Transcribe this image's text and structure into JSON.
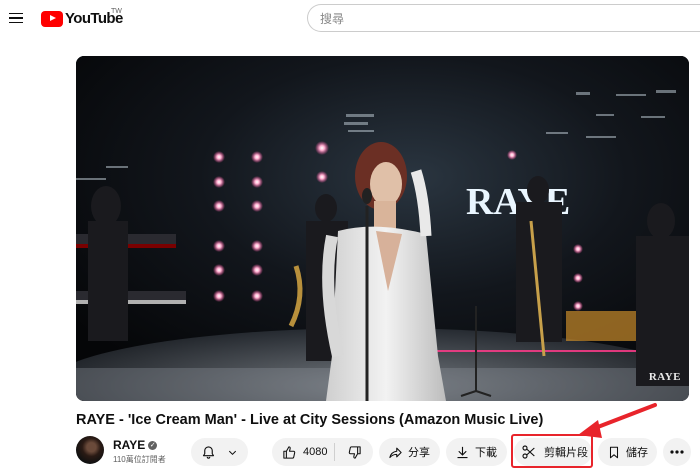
{
  "header": {
    "logo_text": "YouTube",
    "logo_region": "TW",
    "search_placeholder": "搜尋"
  },
  "video": {
    "watermark": "RAYE",
    "stage_sign": "RAYE",
    "title": "RAYE - 'Ice Cream Man' - Live at City Sessions (Amazon Music Live)"
  },
  "channel": {
    "name": "RAYE",
    "subscribers": "110萬位訂閱者"
  },
  "actions": {
    "like_count": "4080",
    "share_label": "分享",
    "download_label": "下載",
    "clip_label": "剪輯片段",
    "save_label": "儲存"
  },
  "annotation": {
    "highlight_color": "#e8242b"
  },
  "colors": {
    "brand_red": "#ff0000",
    "pill_bg": "#f2f2f2"
  },
  "icons": [
    "menu-icon",
    "youtube-logo-icon",
    "verified-icon",
    "bell-icon",
    "chevron-down-icon",
    "thumbs-up-icon",
    "thumbs-down-icon",
    "share-icon",
    "download-icon",
    "scissors-icon",
    "bookmark-icon",
    "more-icon"
  ]
}
